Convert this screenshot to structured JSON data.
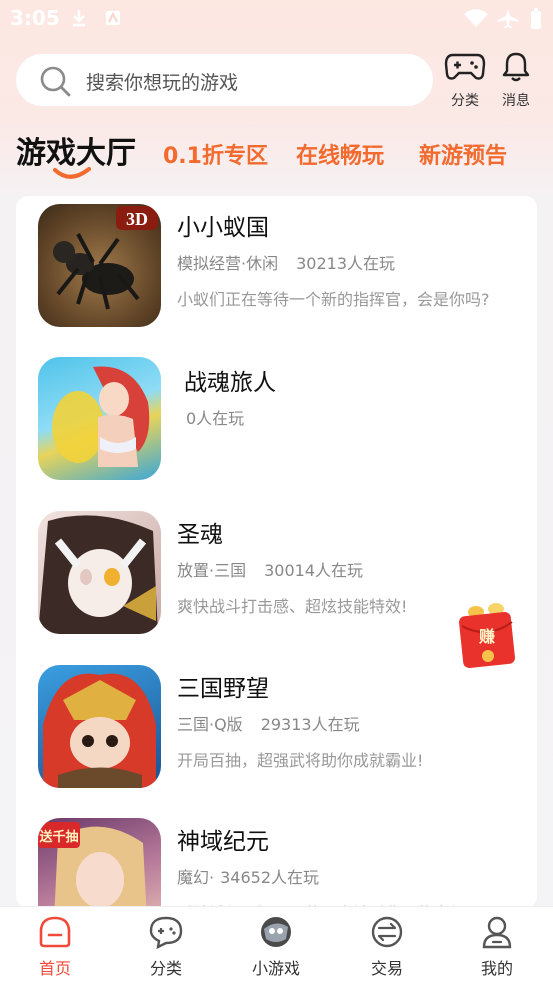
{
  "status_bar": {
    "time": "3:05"
  },
  "search": {
    "placeholder": "搜索你想玩的游戏"
  },
  "top_actions": {
    "category": "分类",
    "messages": "消息"
  },
  "tabs": [
    {
      "label": "游戏大厅",
      "active": true
    },
    {
      "label": "0.1折专区",
      "active": false
    },
    {
      "label": "在线畅玩",
      "active": false
    },
    {
      "label": "新游预告",
      "active": false
    }
  ],
  "games": [
    {
      "name": "小小蚁国",
      "tags": "模拟经营·休闲",
      "players": "30213人在玩",
      "desc": "小蚁们正在等待一个新的指挥官，会是你吗?",
      "badge": "3D"
    },
    {
      "name": "战魂旅人",
      "tags": "",
      "players": "0人在玩",
      "desc": ""
    },
    {
      "name": "圣魂",
      "tags": "放置·三国",
      "players": "30014人在玩",
      "desc": "爽快战斗打击感、超炫技能特效!"
    },
    {
      "name": "三国野望",
      "tags": "三国·Q版",
      "players": "29313人在玩",
      "desc": "开局百抽，超强武将助你成就霸业!"
    },
    {
      "name": "神域纪元",
      "tags": "魔幻·",
      "players": "34652人在玩",
      "desc": "《神域纪元》是一款西方神话背景的魔幻MMO",
      "badge": "送千抽"
    }
  ],
  "red_packet": {
    "label": "赚"
  },
  "bottom_nav": [
    {
      "label": "首页",
      "active": true
    },
    {
      "label": "分类",
      "active": false
    },
    {
      "label": "小游戏",
      "active": false
    },
    {
      "label": "交易",
      "active": false
    },
    {
      "label": "我的",
      "active": false
    }
  ],
  "colors": {
    "accent": "#f26a2e",
    "active_nav": "#f04a3a",
    "red_packet": "#e8322b"
  }
}
